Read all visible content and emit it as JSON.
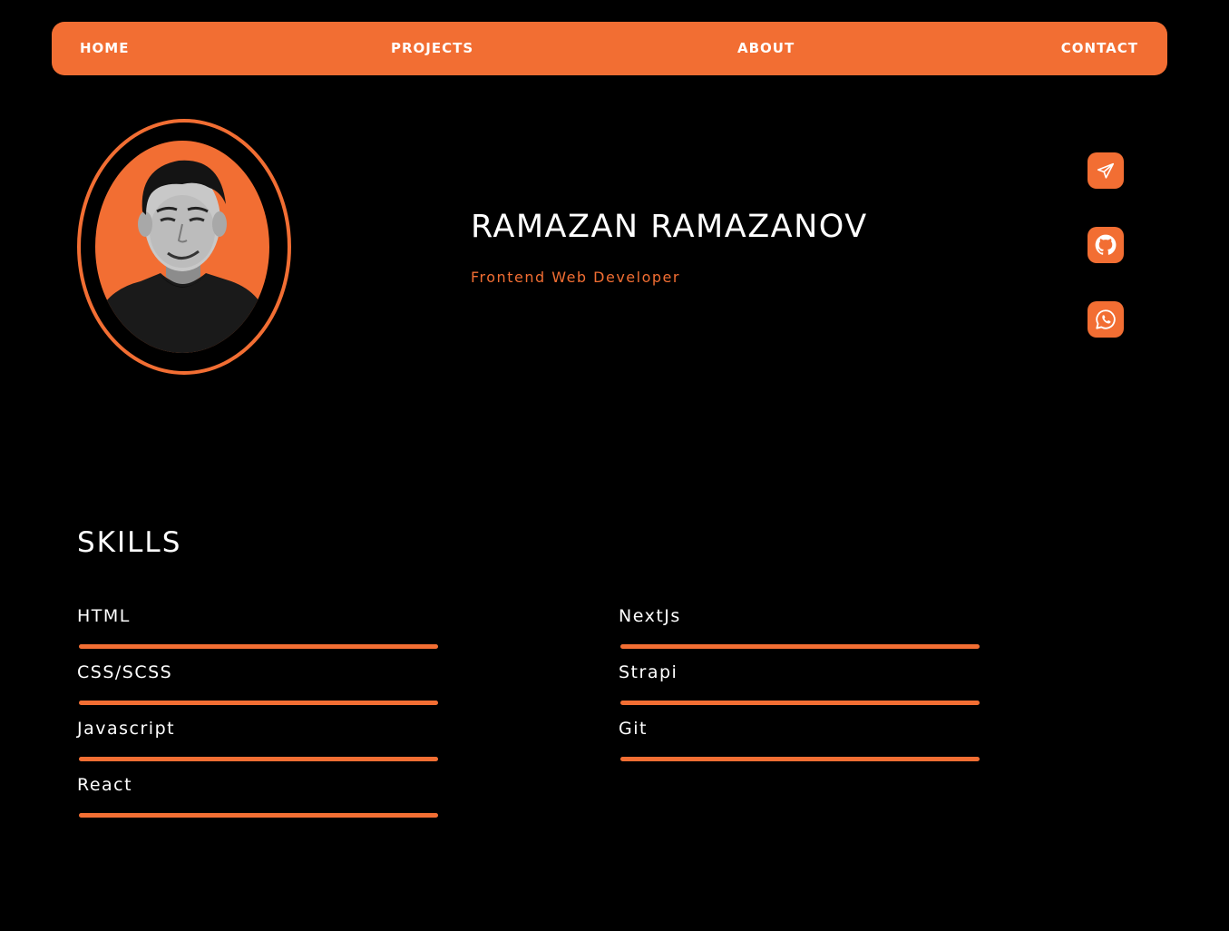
{
  "nav": {
    "home": "HOME",
    "projects": "PROJECTS",
    "about": "ABOUT",
    "contact": "CONTACT"
  },
  "profile": {
    "name": "RAMAZAN RAMAZANOV",
    "role": "Frontend Web Developer",
    "photo": "portrait-photo"
  },
  "social": [
    {
      "icon": "telegram-icon"
    },
    {
      "icon": "github-icon"
    },
    {
      "icon": "whatsapp-icon"
    }
  ],
  "skills": {
    "title": "SKILLS",
    "left": [
      {
        "label": "HTML",
        "level": 1.0
      },
      {
        "label": "CSS/SCSS",
        "level": 1.0
      },
      {
        "label": "Javascript",
        "level": 1.0
      },
      {
        "label": "React",
        "level": 1.0
      }
    ],
    "right": [
      {
        "label": "NextJs",
        "level": 1.0
      },
      {
        "label": "Strapi",
        "level": 1.0
      },
      {
        "label": "Git",
        "level": 1.0
      }
    ]
  },
  "colors": {
    "accent": "#f26e33",
    "background": "#000000",
    "text": "#ffffff"
  }
}
